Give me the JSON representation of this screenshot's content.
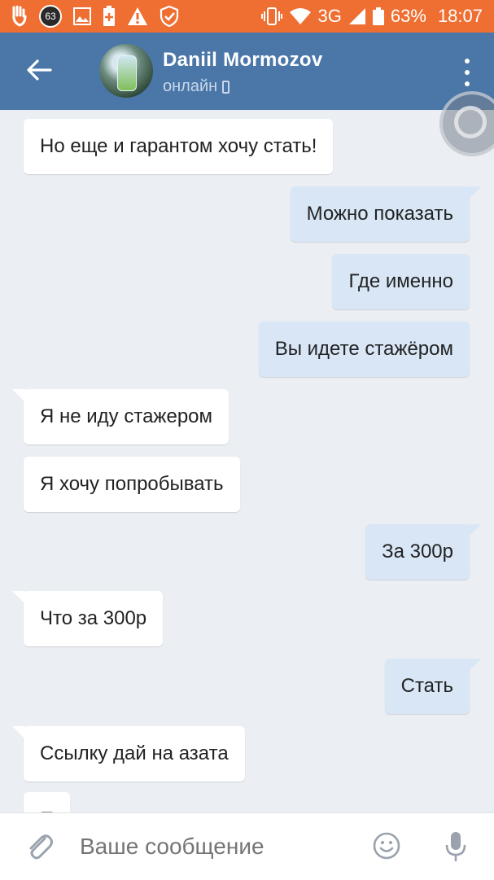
{
  "statusbar": {
    "notification_badge": "63",
    "network": "3G",
    "battery": "63%",
    "time": "18:07",
    "icons": [
      "hand-icon",
      "badge-icon",
      "image-icon",
      "battery-plus-icon",
      "warning-icon",
      "shield-check-icon",
      "vibrate-icon",
      "wifi-icon",
      "signal-icon",
      "battery-icon"
    ]
  },
  "header": {
    "name": "Daniil Mormozov",
    "status": "онлайн",
    "colors": {
      "bar": "#4a76a8",
      "status_bar": "#ef6f32"
    }
  },
  "messages": [
    {
      "dir": "in",
      "text": "Но еще и гарантом хочу стать!"
    },
    {
      "dir": "out",
      "text": "Можно показать"
    },
    {
      "dir": "out",
      "text": "Где именно"
    },
    {
      "dir": "out",
      "text": "Вы идете стажёром"
    },
    {
      "dir": "in",
      "text": "Я не иду стажером"
    },
    {
      "dir": "in",
      "text": "Я хочу попробывать"
    },
    {
      "dir": "out",
      "text": "За 300р"
    },
    {
      "dir": "in",
      "text": "Что за 300р"
    },
    {
      "dir": "out",
      "text": "Стать"
    },
    {
      "dir": "in",
      "text": "Ссылку дай на азата"
    },
    {
      "dir": "in",
      "text": "П"
    }
  ],
  "composer": {
    "placeholder": "Ваше сообщение"
  }
}
